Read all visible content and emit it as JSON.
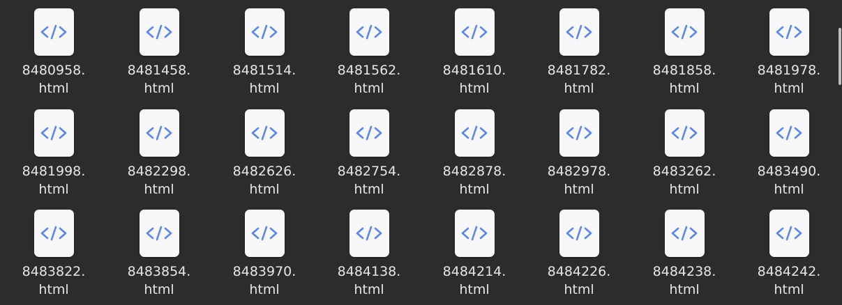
{
  "theme": {
    "background": "#2c2c2c",
    "icon_background": "#f7f7f9",
    "icon_glyph_color": "#5a86e6",
    "label_color": "#e6e6e6"
  },
  "file_icon": {
    "name": "html-code-icon",
    "glyph": "</>"
  },
  "files": [
    {
      "name_line1": "8480958.",
      "name_line2": "html"
    },
    {
      "name_line1": "8481458.",
      "name_line2": "html"
    },
    {
      "name_line1": "8481514.",
      "name_line2": "html"
    },
    {
      "name_line1": "8481562.",
      "name_line2": "html"
    },
    {
      "name_line1": "8481610.",
      "name_line2": "html"
    },
    {
      "name_line1": "8481782.",
      "name_line2": "html"
    },
    {
      "name_line1": "8481858.",
      "name_line2": "html"
    },
    {
      "name_line1": "8481978.",
      "name_line2": "html"
    },
    {
      "name_line1": "8481998.",
      "name_line2": "html"
    },
    {
      "name_line1": "8482298.",
      "name_line2": "html"
    },
    {
      "name_line1": "8482626.",
      "name_line2": "html"
    },
    {
      "name_line1": "8482754.",
      "name_line2": "html"
    },
    {
      "name_line1": "8482878.",
      "name_line2": "html"
    },
    {
      "name_line1": "8482978.",
      "name_line2": "html"
    },
    {
      "name_line1": "8483262.",
      "name_line2": "html"
    },
    {
      "name_line1": "8483490.",
      "name_line2": "html"
    },
    {
      "name_line1": "8483822.",
      "name_line2": "html"
    },
    {
      "name_line1": "8483854.",
      "name_line2": "html"
    },
    {
      "name_line1": "8483970.",
      "name_line2": "html"
    },
    {
      "name_line1": "8484138.",
      "name_line2": "html"
    },
    {
      "name_line1": "8484214.",
      "name_line2": "html"
    },
    {
      "name_line1": "8484226.",
      "name_line2": "html"
    },
    {
      "name_line1": "8484238.",
      "name_line2": "html"
    },
    {
      "name_line1": "8484242.",
      "name_line2": "html"
    }
  ]
}
